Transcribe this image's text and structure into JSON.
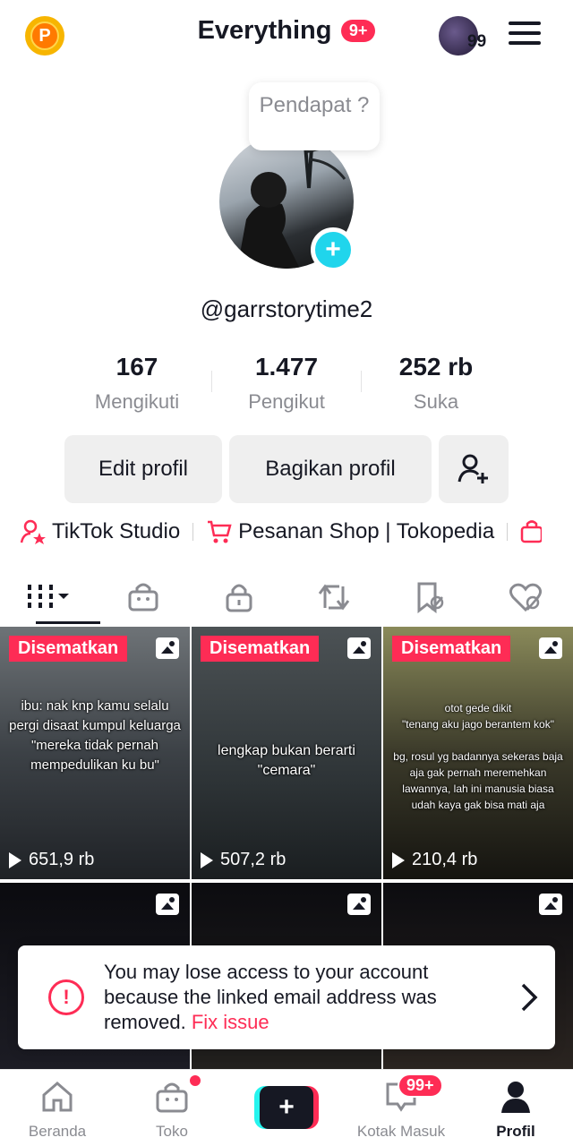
{
  "header": {
    "account_name": "Everything",
    "account_badge": "9+",
    "avatar_count": "99",
    "coin_letter": "P"
  },
  "profile": {
    "note_bubble": "Pendapat ?",
    "username": "@garrstorytime2",
    "stats": [
      {
        "value": "167",
        "label": "Mengikuti"
      },
      {
        "value": "1.477",
        "label": "Pengikut"
      },
      {
        "value": "252 rb",
        "label": "Suka"
      }
    ],
    "buttons": {
      "edit": "Edit profil",
      "share": "Bagikan profil"
    }
  },
  "links": [
    {
      "label": "TikTok Studio",
      "icon": "person-star-icon"
    },
    {
      "label": "Pesanan Shop | Tokopedia",
      "icon": "cart-icon"
    }
  ],
  "tabs": [
    "videos-grid-icon",
    "shop-bag-icon",
    "lock-icon",
    "repost-icon",
    "favorites-icon",
    "liked-hidden-icon"
  ],
  "videos": [
    {
      "pinned": "Disematkan",
      "text": "ibu: nak knp kamu selalu pergi disaat kumpul keluarga\n\"mereka tidak pernah mempedulikan ku bu\"",
      "views": "651,9 rb"
    },
    {
      "pinned": "Disematkan",
      "text": "lengkap bukan berarti \"cemara\"",
      "views": "507,2 rb"
    },
    {
      "pinned": "Disematkan",
      "text": "otot gede dikit\n\"tenang aku jago berantem kok\"\n\nbg, rosul yg badannya sekeras baja aja gak pernah meremehkan lawannya, lah ini manusia biasa udah kaya gak bisa mati aja",
      "views": "210,4 rb"
    }
  ],
  "toast": {
    "message": "You may lose access to your account because the linked email address was removed.",
    "action": "Fix issue"
  },
  "bottom_nav": {
    "home": "Beranda",
    "shop": "Toko",
    "inbox": "Kotak Masuk",
    "inbox_badge": "99+",
    "profile": "Profil"
  },
  "colors": {
    "accent": "#fe2c55",
    "teal": "#20d5ec"
  }
}
